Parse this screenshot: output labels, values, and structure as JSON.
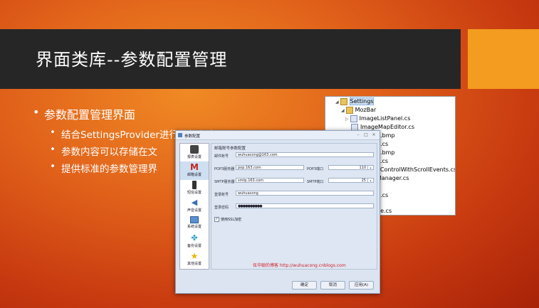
{
  "slide": {
    "title": "界面类库--参数配置管理",
    "bullets": {
      "main": "参数配置管理界面",
      "sub": [
        "结合SettingsProvider进行数据保存",
        "参数内容可以存储在文",
        "提供标准的参数管理界"
      ]
    },
    "colors": {
      "title_bar": "#262626",
      "accent": "#f39c1f",
      "background": "#d9521a"
    }
  },
  "tree": {
    "rows": [
      {
        "text": "Settings",
        "icon": "folder-icon",
        "selected": true
      },
      {
        "text": "MozBar",
        "icon": "folder-icon"
      },
      {
        "text": "ImageListPanel.cs",
        "icon": "file-icon"
      },
      {
        "text": "ImageMapEditor.cs",
        "icon": "file-icon"
      },
      {
        "text": "n.bmp",
        "icon": "file-icon"
      },
      {
        "text": "n.cs",
        "icon": "file-icon"
      },
      {
        "text": "e.bmp",
        "icon": "file-icon"
      },
      {
        "text": "e.cs",
        "icon": "file-icon"
      },
      {
        "text": "eControlWithScrollEvents.cs",
        "icon": "file-icon"
      },
      {
        "text": "Manager.cs",
        "icon": "file-icon"
      },
      {
        "text": "s",
        "icon": "file-icon"
      },
      {
        "text": "g.cs",
        "icon": "file-icon"
      },
      {
        "text": "s",
        "icon": "file-icon"
      },
      {
        "text": "ge.cs",
        "icon": "file-icon"
      }
    ]
  },
  "dialog": {
    "title": "参数配置",
    "nav": [
      {
        "label": "报表设置",
        "icon": "camera-icon"
      },
      {
        "label": "邮箱设置",
        "icon": "mail-icon",
        "active": true
      },
      {
        "label": "短信设置",
        "icon": "phone-icon"
      },
      {
        "label": "声音设置",
        "icon": "speaker-icon"
      },
      {
        "label": "系统设置",
        "icon": "computer-icon"
      },
      {
        "label": "备份设置",
        "icon": "puzzle-icon"
      },
      {
        "label": "其他设置",
        "icon": "star-icon"
      }
    ],
    "panel_title": "邮箱账号参数配置",
    "fields": {
      "account_label": "邮件账号",
      "account_value": "wuhuacong@163.com",
      "pop3_label": "POP3服务器",
      "pop3_value": "pop.163.com",
      "pop3_port_label": "POP3端口",
      "pop3_port_value": "110",
      "smtp_label": "SMTP服务器",
      "smtp_value": "smtp.163.com",
      "smtp_port_label": "SMTP端口",
      "smtp_port_value": "25",
      "login_label": "登录账号",
      "login_value": "wuhuacong",
      "password_label": "登录密码",
      "password_value": "●●●●●●●●●●"
    },
    "ssl_label": "使用SSL加密",
    "link": "伍华聪的博客 http://wuhuacong.cnblogs.com",
    "buttons": {
      "ok": "确定",
      "cancel": "取消",
      "apply": "应用(A)"
    }
  }
}
